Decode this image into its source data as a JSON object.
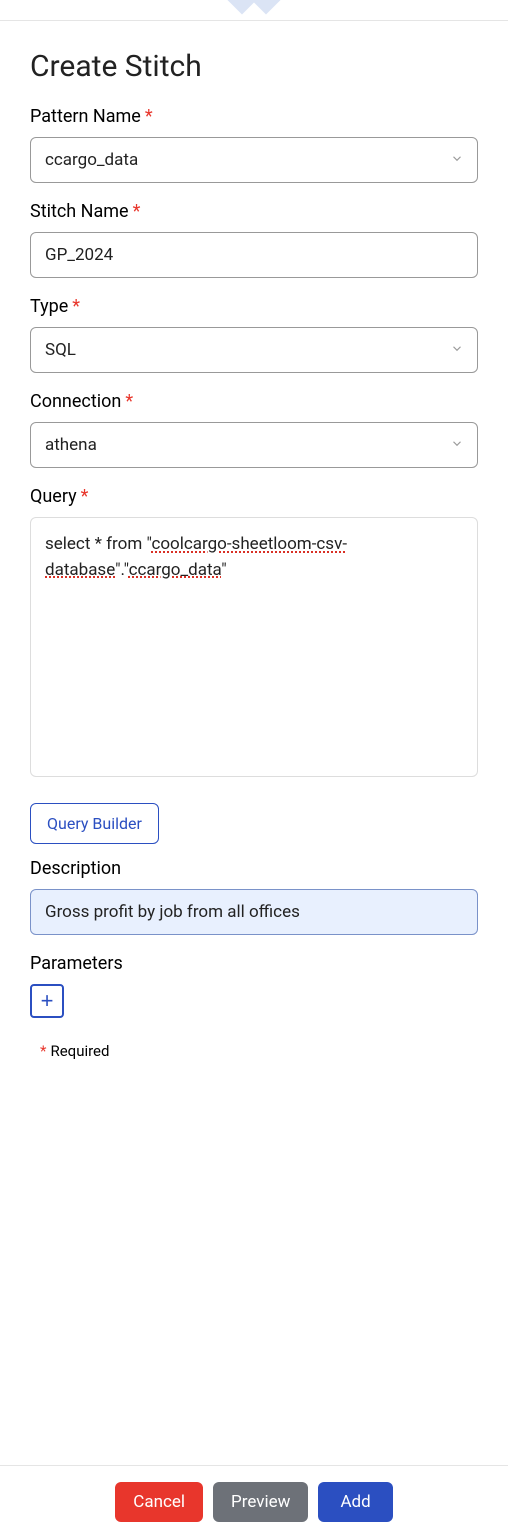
{
  "header": {
    "title": "Create Stitch"
  },
  "fields": {
    "pattern_name": {
      "label": "Pattern Name",
      "value": "ccargo_data"
    },
    "stitch_name": {
      "label": "Stitch Name",
      "value": "GP_2024"
    },
    "type": {
      "label": "Type",
      "value": "SQL"
    },
    "connection": {
      "label": "Connection",
      "value": "athena"
    },
    "query": {
      "label": "Query",
      "value_prefix": "select * from \"",
      "value_db": "coolcargo-sheetloom-csv-database",
      "value_mid": "\".\"",
      "value_table": "ccargo_data",
      "value_suffix": "\""
    },
    "description": {
      "label": "Description",
      "value": "Gross profit by job from all offices"
    },
    "parameters": {
      "label": "Parameters"
    }
  },
  "buttons": {
    "query_builder": "Query Builder",
    "cancel": "Cancel",
    "preview": "Preview",
    "add": "Add"
  },
  "text": {
    "required_note": "Required"
  }
}
